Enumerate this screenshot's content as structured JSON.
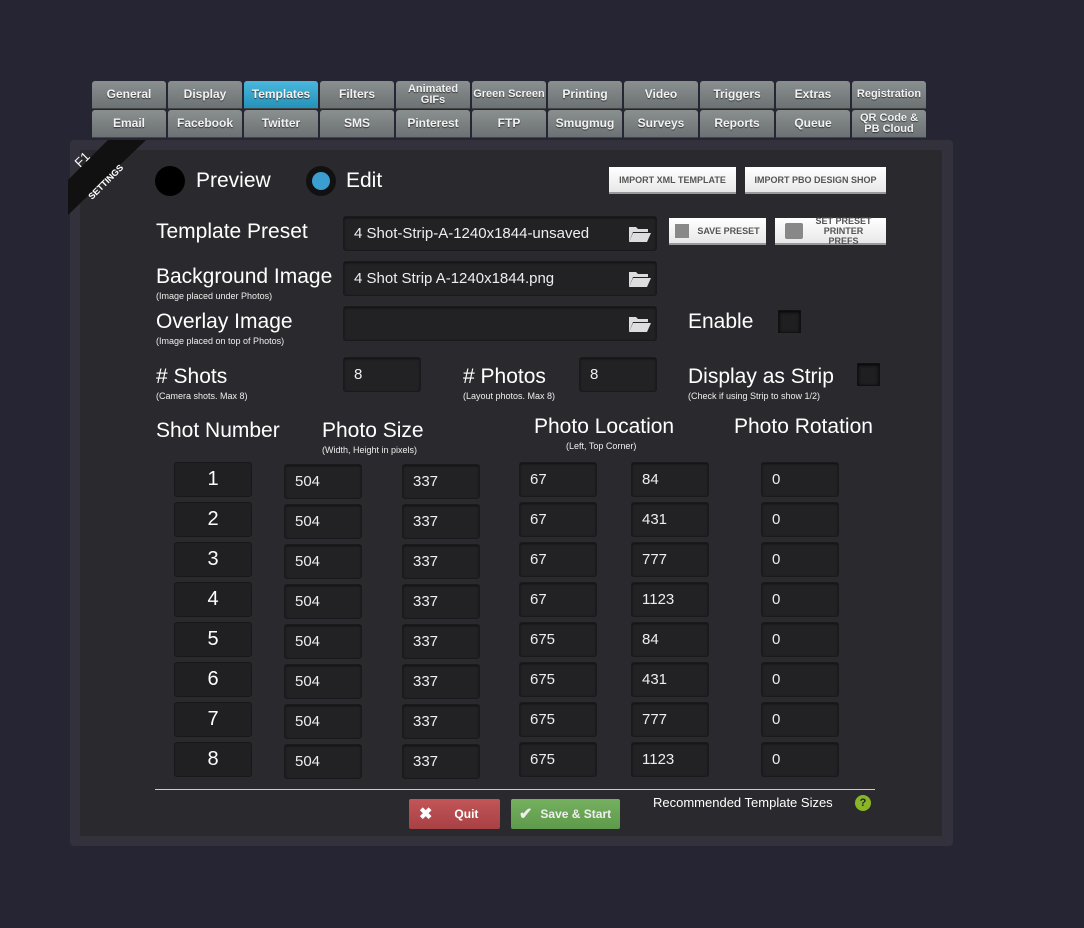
{
  "tabs_row1": [
    "General",
    "Display",
    "Templates",
    "Filters",
    "Animated GIFs",
    "Green Screen",
    "Printing",
    "Video",
    "Triggers",
    "Extras",
    "Registration"
  ],
  "tabs_row2": [
    "Email",
    "Facebook",
    "Twitter",
    "SMS",
    "Pinterest",
    "FTP",
    "Smugmug",
    "Surveys",
    "Reports",
    "Queue",
    "QR Code & PB Cloud"
  ],
  "active_tab": "Templates",
  "ribbon": {
    "key": "F1",
    "label": "SETTINGS"
  },
  "mode": {
    "preview": "Preview",
    "edit": "Edit",
    "selected": "Edit"
  },
  "buttons": {
    "import_xml": "IMPORT XML TEMPLATE",
    "import_pbo": "IMPORT PBO DESIGN SHOP",
    "save_preset": "SAVE PRESET",
    "set_preset_printer": "SET PRESET PRINTER PREFS",
    "quit": "Quit",
    "save_start": "Save & Start"
  },
  "template_preset": {
    "label": "Template Preset",
    "value": "4 Shot-Strip-A-1240x1844-unsaved"
  },
  "background_image": {
    "label": "Background Image",
    "sub": "(Image placed under Photos)",
    "value": "4 Shot Strip A-1240x1844.png"
  },
  "overlay_image": {
    "label": "Overlay Image",
    "sub": "(Image placed on top of Photos)",
    "value": "",
    "enable_label": "Enable",
    "enabled": false
  },
  "shots": {
    "label": "# Shots",
    "sub": "(Camera shots. Max 8)",
    "value": "8"
  },
  "photos": {
    "label": "# Photos",
    "sub": "(Layout photos. Max 8)",
    "value": "8"
  },
  "display_strip": {
    "label": "Display as Strip",
    "sub": "(Check if using Strip to show 1/2)",
    "checked": false
  },
  "columns": {
    "shot_number": "Shot Number",
    "photo_size": "Photo Size",
    "photo_size_sub": "(Width, Height in pixels)",
    "photo_location": "Photo Location",
    "photo_location_sub": "(Left, Top Corner)",
    "photo_rotation": "Photo Rotation"
  },
  "rows": [
    {
      "shot": "1",
      "width": "504",
      "height": "337",
      "left": "67",
      "top": "84",
      "rotation": "0"
    },
    {
      "shot": "2",
      "width": "504",
      "height": "337",
      "left": "67",
      "top": "431",
      "rotation": "0"
    },
    {
      "shot": "3",
      "width": "504",
      "height": "337",
      "left": "67",
      "top": "777",
      "rotation": "0"
    },
    {
      "shot": "4",
      "width": "504",
      "height": "337",
      "left": "67",
      "top": "1123",
      "rotation": "0"
    },
    {
      "shot": "5",
      "width": "504",
      "height": "337",
      "left": "675",
      "top": "84",
      "rotation": "0"
    },
    {
      "shot": "6",
      "width": "504",
      "height": "337",
      "left": "675",
      "top": "431",
      "rotation": "0"
    },
    {
      "shot": "7",
      "width": "504",
      "height": "337",
      "left": "675",
      "top": "777",
      "rotation": "0"
    },
    {
      "shot": "8",
      "width": "504",
      "height": "337",
      "left": "675",
      "top": "1123",
      "rotation": "0"
    }
  ],
  "recommended": "Recommended Template Sizes",
  "colors": {
    "accent": "#3a9fd0",
    "quit": "#b84a4c",
    "save": "#6aa755",
    "help": "#8ab526"
  }
}
